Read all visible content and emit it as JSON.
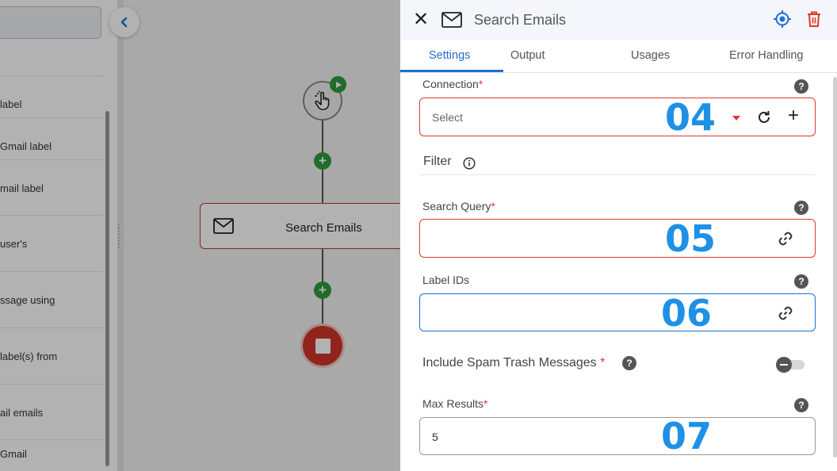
{
  "sidebar": {
    "items": [
      {
        "label": "label"
      },
      {
        "label": "Gmail label"
      },
      {
        "label": "mail label"
      },
      {
        "label": "user's"
      },
      {
        "label": "ssage using"
      },
      {
        "label": "label(s) from"
      },
      {
        "label": "ail emails"
      },
      {
        "label": "Gmail"
      }
    ]
  },
  "canvas": {
    "collapse_icon": "chevron-left-icon",
    "trigger_icon": "click-hand-icon",
    "play_icon": "play-icon",
    "add_symbol": "+",
    "step": {
      "label": "Search Emails",
      "icon": "mail-icon"
    },
    "stop_icon": "stop-icon"
  },
  "panel": {
    "title": "Search Emails",
    "close_symbol": "✕",
    "tabs": [
      {
        "label": "Settings",
        "active": true
      },
      {
        "label": "Output"
      },
      {
        "label": "Usages"
      },
      {
        "label": "Error Handling"
      }
    ],
    "connection": {
      "label": "Connection",
      "required_mark": "*",
      "placeholder": "Select",
      "overlay": "04",
      "add_symbol": "+"
    },
    "filter": {
      "label": "Filter"
    },
    "search_query": {
      "label": "Search Query",
      "required_mark": "*",
      "value": "",
      "overlay": "05"
    },
    "label_ids": {
      "label": "Label IDs",
      "value": "",
      "overlay": "06"
    },
    "include_spam": {
      "label": "Include Spam Trash Messages",
      "required_mark": "*",
      "enabled": false
    },
    "max_results": {
      "label": "Max Results",
      "required_mark": "*",
      "value": "5",
      "overlay": "07"
    },
    "help_symbol": "?"
  },
  "colors": {
    "accent": "#1e6fd0",
    "error": "#e0372c",
    "success": "#2e9d3b",
    "overlay_number": "#1e90e6"
  }
}
